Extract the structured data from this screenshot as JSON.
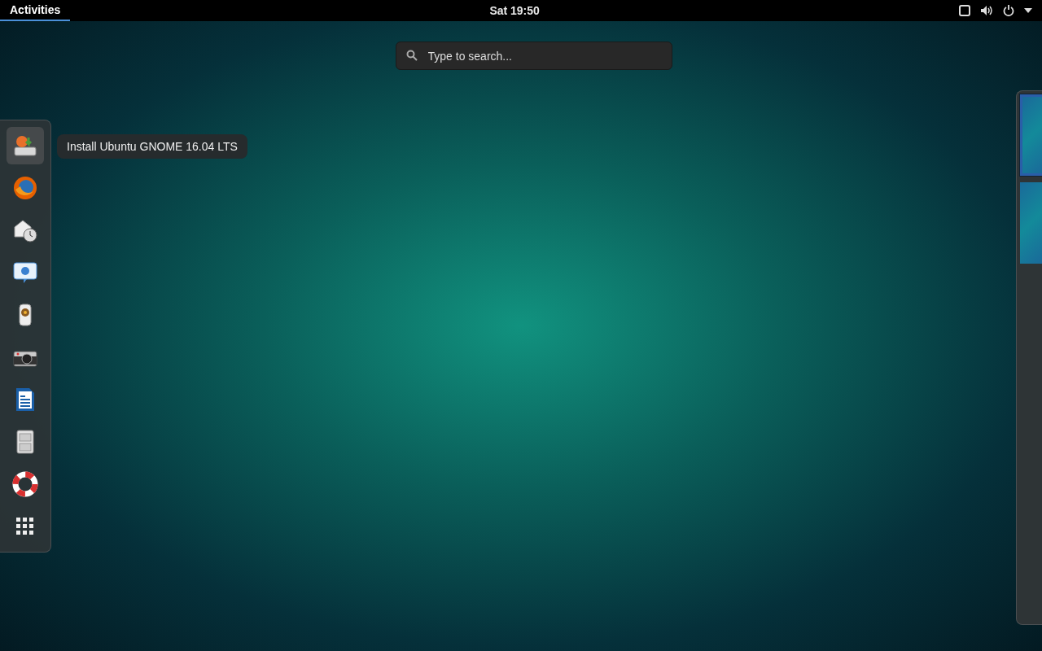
{
  "top_bar": {
    "activities": {
      "label": "Activities",
      "selected": true
    },
    "clock": "Sat 19:50"
  },
  "search": {
    "placeholder": "Type to search..."
  },
  "dash": {
    "items": [
      {
        "kind": "installer",
        "selected": true,
        "tooltip": "Install Ubuntu GNOME 16.04 LTS"
      },
      {
        "kind": "browser",
        "selected": false
      },
      {
        "kind": "mailclock",
        "selected": false
      },
      {
        "kind": "chat",
        "selected": false
      },
      {
        "kind": "speaker",
        "selected": false
      },
      {
        "kind": "camera",
        "selected": false
      },
      {
        "kind": "document",
        "selected": false
      },
      {
        "kind": "cabinet",
        "selected": false
      },
      {
        "kind": "lifebuoy",
        "selected": false
      },
      {
        "kind": "grid",
        "selected": false
      }
    ]
  },
  "workspaces": [
    {
      "selected": true
    },
    {
      "selected": false
    }
  ]
}
